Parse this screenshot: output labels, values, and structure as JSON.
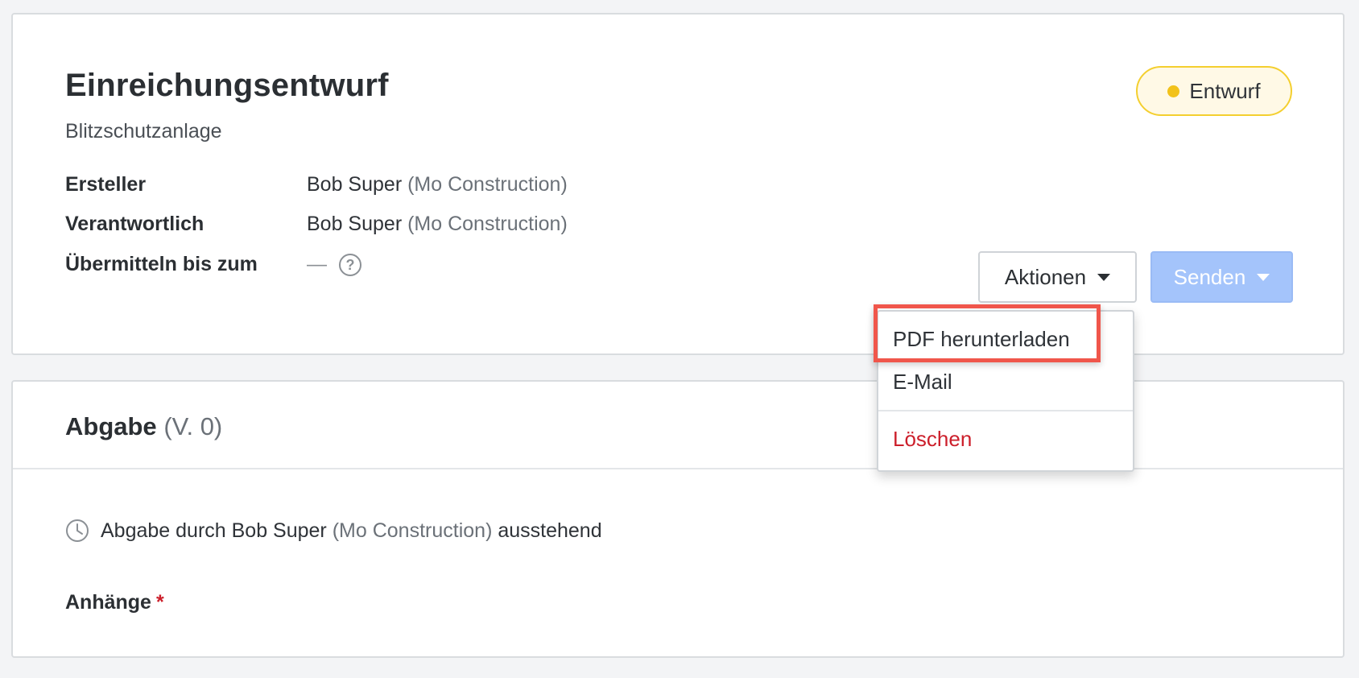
{
  "header": {
    "title": "Einreichungsentwurf",
    "subtitle": "Blitzschutzanlage",
    "status": "Entwurf"
  },
  "details": {
    "creator_label": "Ersteller",
    "creator_name": "Bob Super",
    "creator_company": "(Mo Construction)",
    "responsible_label": "Verantwortlich",
    "responsible_name": "Bob Super",
    "responsible_company": "(Mo Construction)",
    "due_label": "Übermitteln bis zum",
    "due_value": "—"
  },
  "actions": {
    "actions_label": "Aktionen",
    "send_label": "Senden"
  },
  "menu": {
    "items": [
      {
        "label": "PDF herunterladen"
      },
      {
        "label": "E-Mail"
      },
      {
        "label": "Löschen"
      }
    ]
  },
  "submission": {
    "title": "Abgabe",
    "version": "(V. 0)",
    "pending_prefix": "Abgabe durch Bob Super",
    "pending_company": "(Mo Construction)",
    "pending_suffix": "ausstehend",
    "attachments_label": "Anhänge",
    "required_mark": "*"
  },
  "colors": {
    "status_dot": "#f2c21a",
    "status_border": "#f4cf2f",
    "send_button": "#a4c4fb",
    "delete_text": "#cc1f2b",
    "highlight": "#f0564b"
  },
  "icons": [
    "help-icon",
    "clock-icon",
    "caret-down-icon"
  ]
}
